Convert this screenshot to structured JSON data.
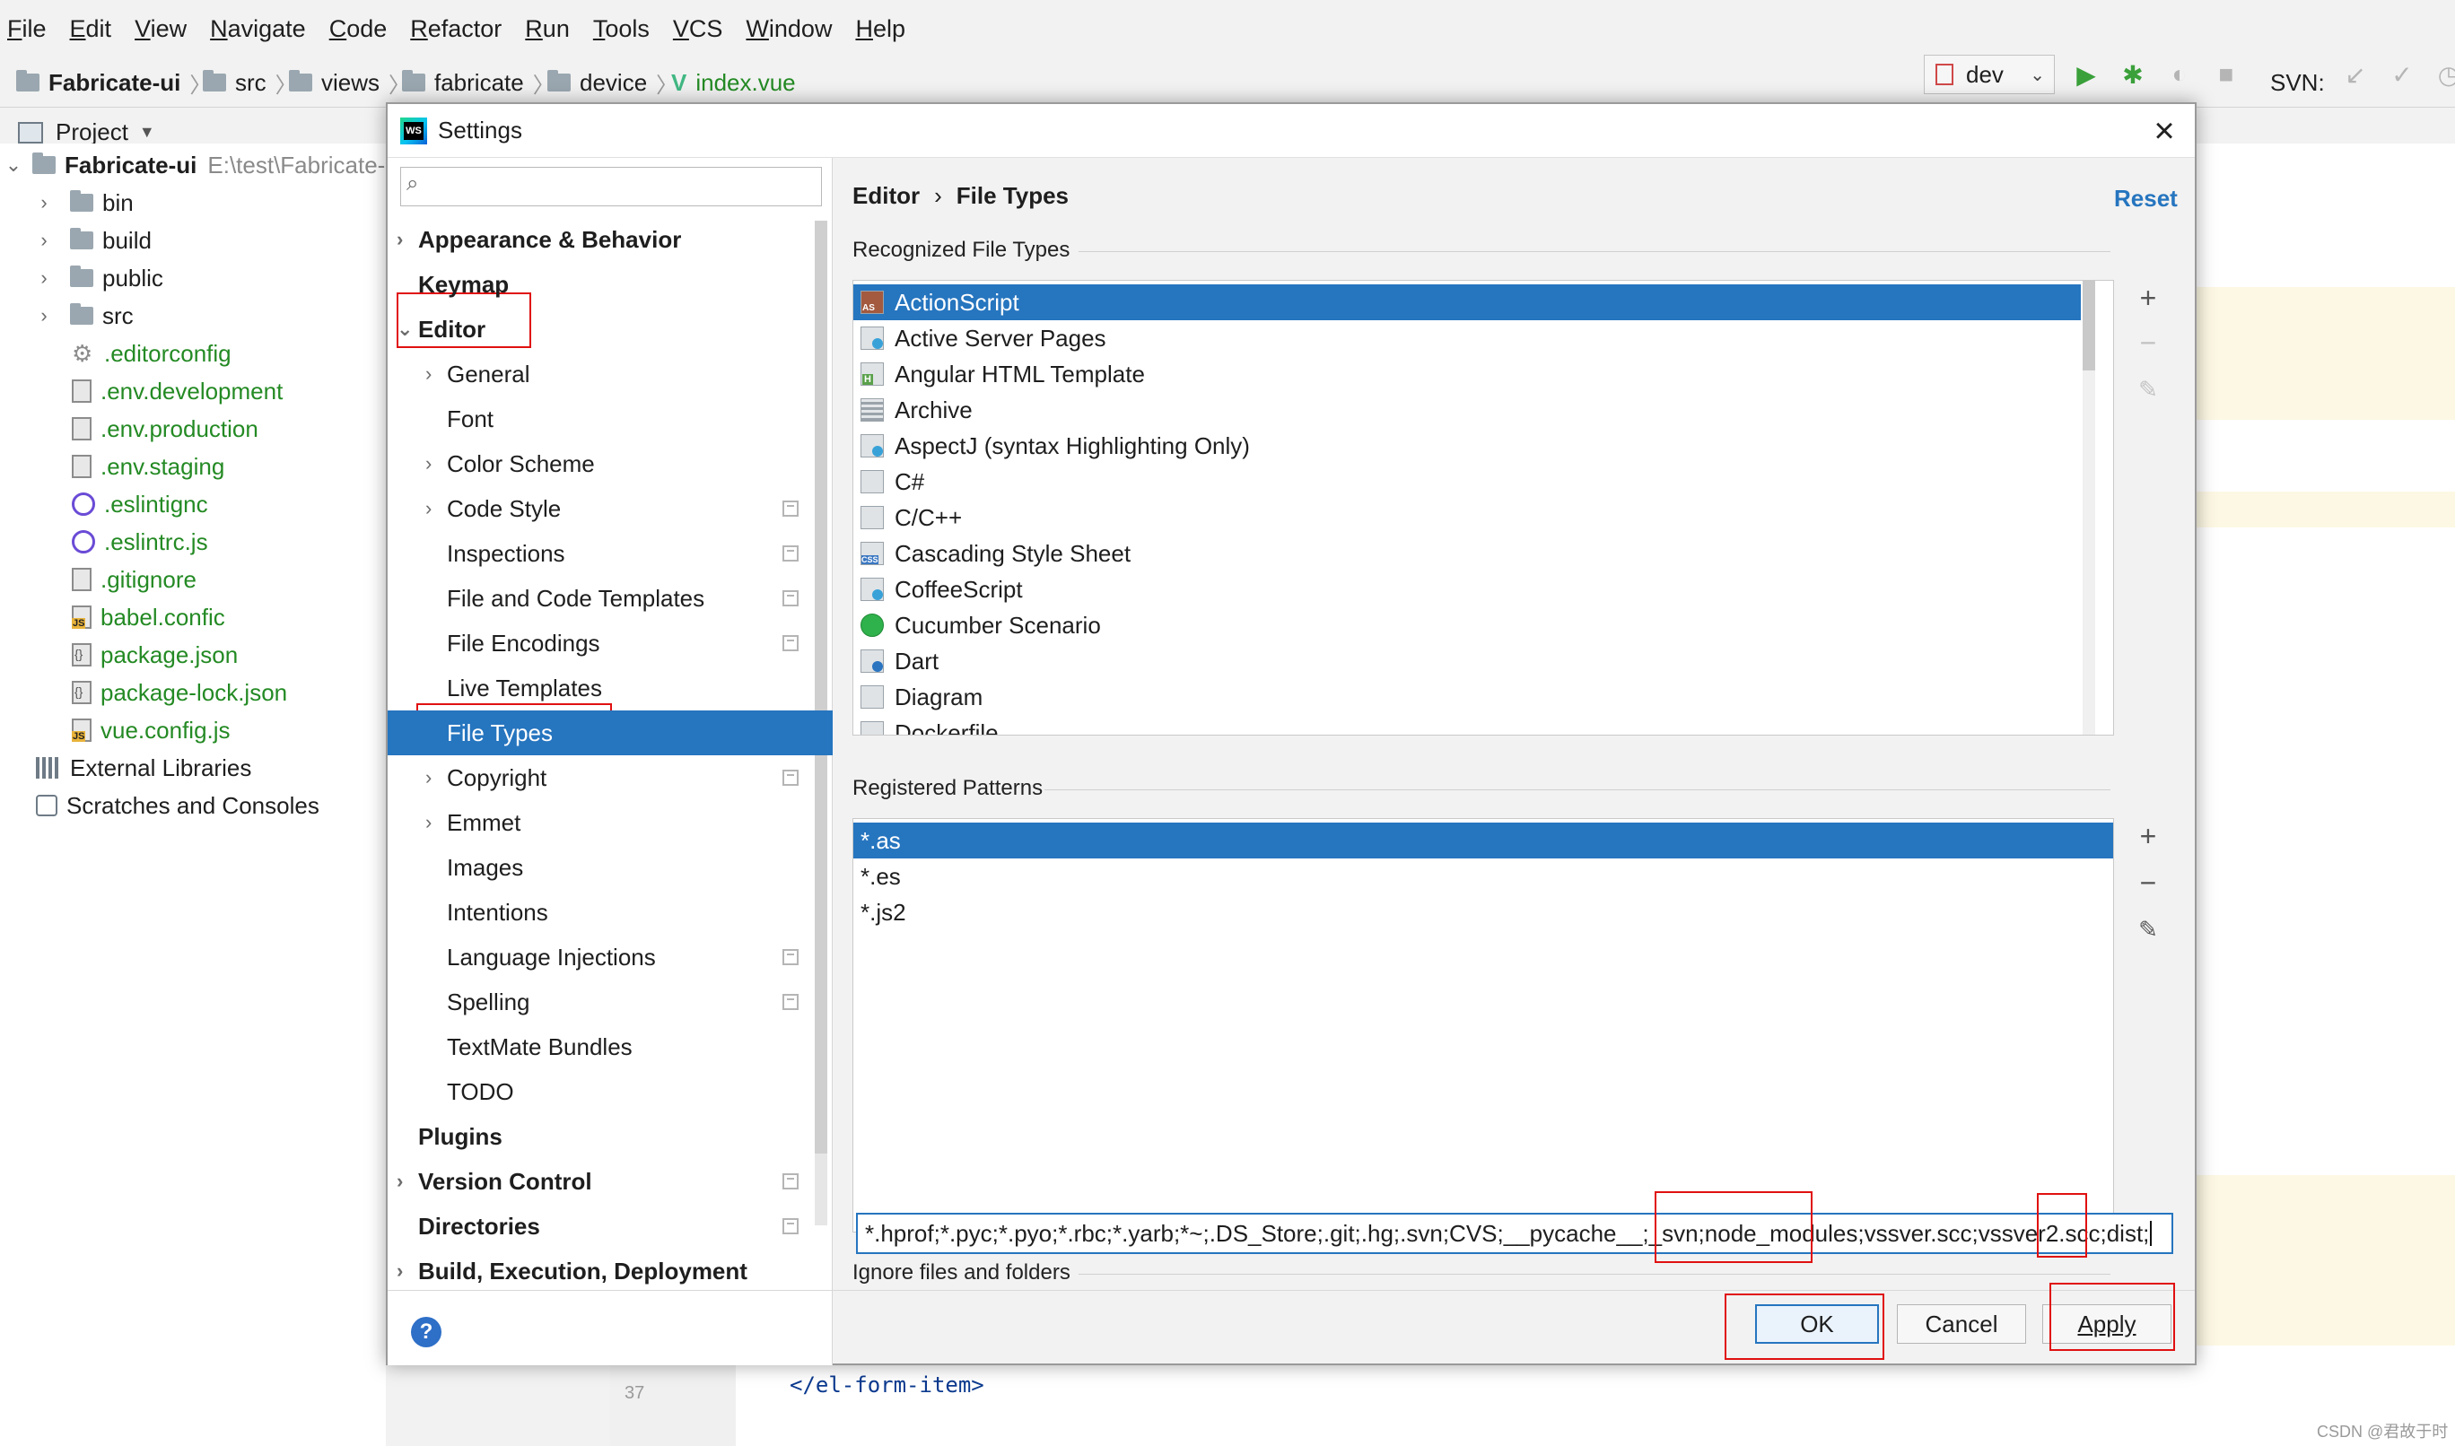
{
  "menu": [
    "File",
    "Edit",
    "View",
    "Navigate",
    "Code",
    "Refactor",
    "Run",
    "Tools",
    "VCS",
    "Window",
    "Help"
  ],
  "breadcrumb": [
    "Fabricate-ui",
    "src",
    "views",
    "fabricate",
    "device",
    "index.vue"
  ],
  "toolbar": {
    "run_config": "dev",
    "svn_label": "SVN:"
  },
  "project_panel": {
    "title": "Project",
    "root_name": "Fabricate-ui",
    "root_path": "E:\\test\\Fabricate-",
    "items": [
      {
        "label": "bin",
        "kind": "folder"
      },
      {
        "label": "build",
        "kind": "folder"
      },
      {
        "label": "public",
        "kind": "folder"
      },
      {
        "label": "src",
        "kind": "folder"
      },
      {
        "label": ".editorconfig",
        "kind": "gear"
      },
      {
        "label": ".env.development",
        "kind": "doc"
      },
      {
        "label": ".env.production",
        "kind": "doc"
      },
      {
        "label": ".env.staging",
        "kind": "doc"
      },
      {
        "label": ".eslintignc",
        "kind": "eslint"
      },
      {
        "label": ".eslintrc.js",
        "kind": "eslint"
      },
      {
        "label": ".gitignore",
        "kind": "doc"
      },
      {
        "label": "babel.confic",
        "kind": "js"
      },
      {
        "label": "package.json",
        "kind": "json"
      },
      {
        "label": "package-lock.json",
        "kind": "json"
      },
      {
        "label": "vue.config.js",
        "kind": "js"
      }
    ],
    "external_libraries": "External Libraries",
    "scratches": "Scratches and Consoles"
  },
  "editor": {
    "line_number": "37",
    "code_line": "</el-form-item>"
  },
  "settings": {
    "title": "Settings",
    "search_placeholder": "",
    "nav": [
      {
        "label": "Appearance & Behavior",
        "level": 0,
        "bold": true,
        "arrow": "right"
      },
      {
        "label": "Keymap",
        "level": 0,
        "bold": true,
        "arrow": ""
      },
      {
        "label": "Editor",
        "level": 0,
        "bold": true,
        "arrow": "down"
      },
      {
        "label": "General",
        "level": 1,
        "bold": false,
        "arrow": "right"
      },
      {
        "label": "Font",
        "level": 1,
        "bold": false,
        "arrow": ""
      },
      {
        "label": "Color Scheme",
        "level": 1,
        "bold": false,
        "arrow": "right"
      },
      {
        "label": "Code Style",
        "level": 1,
        "bold": false,
        "arrow": "right",
        "copy": true
      },
      {
        "label": "Inspections",
        "level": 1,
        "bold": false,
        "arrow": "",
        "copy": true
      },
      {
        "label": "File and Code Templates",
        "level": 1,
        "bold": false,
        "arrow": "",
        "copy": true
      },
      {
        "label": "File Encodings",
        "level": 1,
        "bold": false,
        "arrow": "",
        "copy": true
      },
      {
        "label": "Live Templates",
        "level": 1,
        "bold": false,
        "arrow": ""
      },
      {
        "label": "File Types",
        "level": 1,
        "bold": false,
        "arrow": "",
        "selected": true
      },
      {
        "label": "Copyright",
        "level": 1,
        "bold": false,
        "arrow": "right",
        "copy": true
      },
      {
        "label": "Emmet",
        "level": 1,
        "bold": false,
        "arrow": "right"
      },
      {
        "label": "Images",
        "level": 1,
        "bold": false,
        "arrow": ""
      },
      {
        "label": "Intentions",
        "level": 1,
        "bold": false,
        "arrow": ""
      },
      {
        "label": "Language Injections",
        "level": 1,
        "bold": false,
        "arrow": "",
        "copy": true
      },
      {
        "label": "Spelling",
        "level": 1,
        "bold": false,
        "arrow": "",
        "copy": true
      },
      {
        "label": "TextMate Bundles",
        "level": 1,
        "bold": false,
        "arrow": ""
      },
      {
        "label": "TODO",
        "level": 1,
        "bold": false,
        "arrow": ""
      },
      {
        "label": "Plugins",
        "level": 0,
        "bold": true,
        "arrow": ""
      },
      {
        "label": "Version Control",
        "level": 0,
        "bold": true,
        "arrow": "right",
        "copy": true
      },
      {
        "label": "Directories",
        "level": 0,
        "bold": true,
        "arrow": "",
        "copy": true
      },
      {
        "label": "Build, Execution, Deployment",
        "level": 0,
        "bold": true,
        "arrow": "right"
      }
    ],
    "breadcrumb_parent": "Editor",
    "breadcrumb_sep": "›",
    "breadcrumb_current": "File Types",
    "reset_label": "Reset",
    "recognized_label": "Recognized File Types",
    "file_types": [
      {
        "label": "ActionScript",
        "icon": "as"
      },
      {
        "label": "Active Server Pages",
        "icon": "asp"
      },
      {
        "label": "Angular HTML Template",
        "icon": "html"
      },
      {
        "label": "Archive",
        "icon": "arch"
      },
      {
        "label": "AspectJ (syntax Highlighting Only)",
        "icon": "asp"
      },
      {
        "label": "C#",
        "icon": "doc"
      },
      {
        "label": "C/C++",
        "icon": "doc"
      },
      {
        "label": "Cascading Style Sheet",
        "icon": "css"
      },
      {
        "label": "CoffeeScript",
        "icon": "asp"
      },
      {
        "label": "Cucumber Scenario",
        "icon": "cuc"
      },
      {
        "label": "Dart",
        "icon": "dart"
      },
      {
        "label": "Diagram",
        "icon": "doc"
      },
      {
        "label": "Dockerfile",
        "icon": "doc"
      }
    ],
    "patterns_label": "Registered Patterns",
    "patterns": [
      "*.as",
      "*.es",
      "*.js2"
    ],
    "ignore_label": "Ignore files and folders",
    "ignore_value": "*.hprof;*.pyc;*.pyo;*.rbc;*.yarb;*~;.DS_Store;.git;.hg;.svn;CVS;__pycache__;_svn;node_modules;vssver.scc;vssver2.scc;dist;",
    "ok_label": "OK",
    "cancel_label": "Cancel",
    "apply_label": "Apply"
  },
  "watermark": "CSDN @君故于时",
  "colors": {
    "selection": "#2675bf",
    "highlight_box": "#e01010",
    "project_file_text": "#248a24"
  }
}
